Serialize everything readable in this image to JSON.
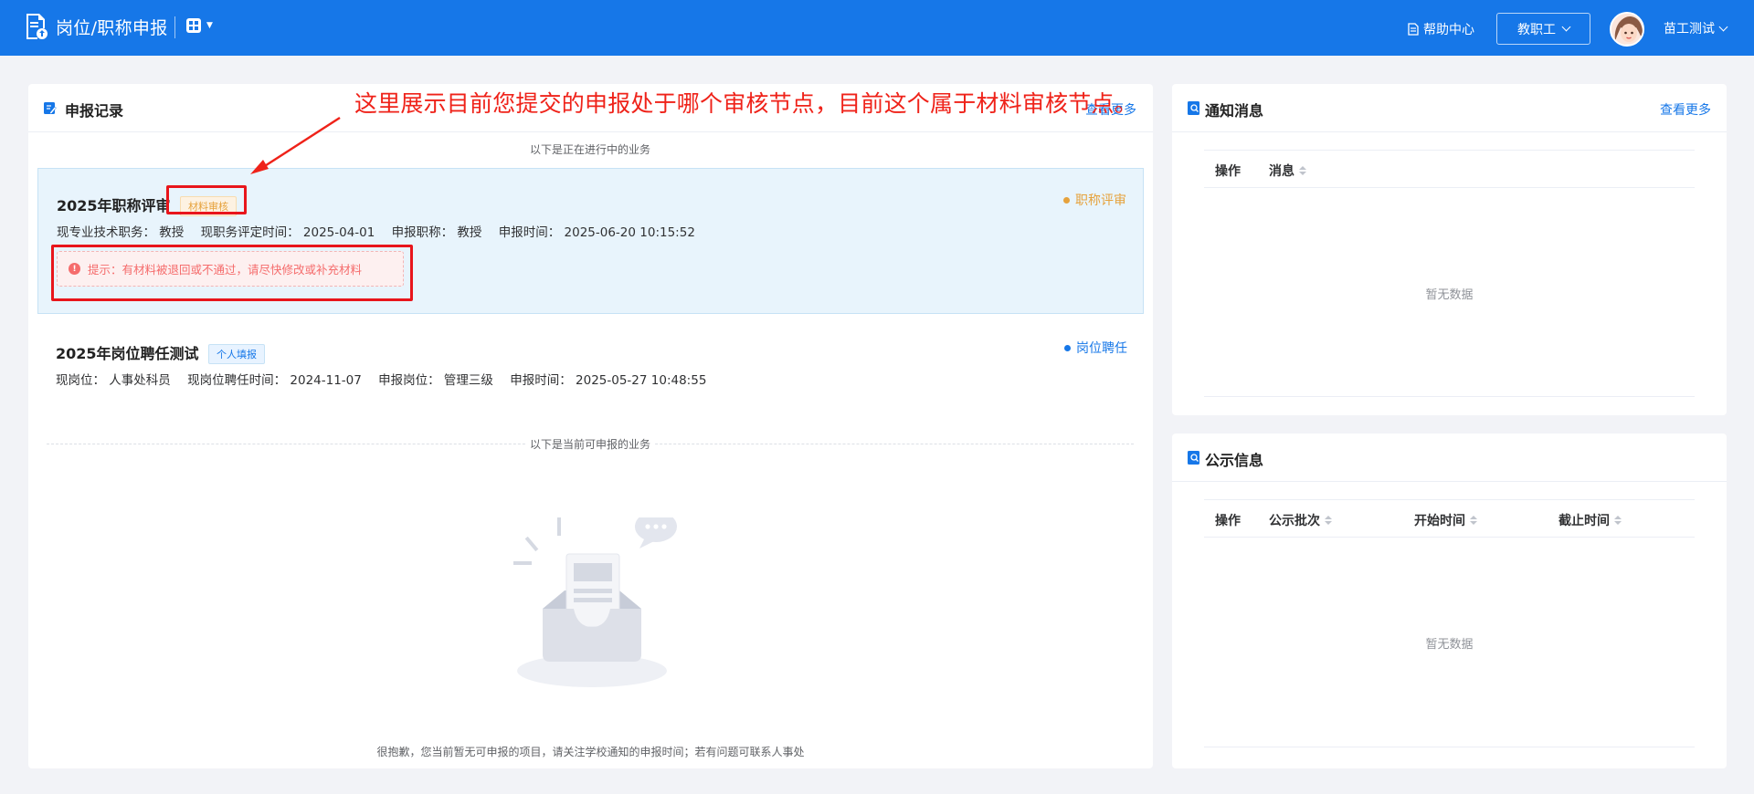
{
  "header": {
    "title": "岗位/职称申报",
    "help_label": "帮助中心",
    "role_label": "教职工",
    "user_name": "苗工测试"
  },
  "records_panel": {
    "title": "申报记录",
    "view_more": "查看更多",
    "in_progress_divider": "以下是正在进行中的业务",
    "available_divider": "以下是当前可申报的业务",
    "empty_note": "很抱歉，您当前暂无可申报的项目，请关注学校通知的申报时间；若有问题可联系人事处",
    "records": [
      {
        "title": "2025年职称评审",
        "tag": "材料审核",
        "type": "职称评审",
        "meta": [
          "现专业技术职务：  教授",
          "现职务评定时间：  2025-04-01",
          "申报职称：  教授",
          "申报时间：  2025-06-20 10:15:52"
        ],
        "warning": "提示：有材料被退回或不通过，请尽快修改或补充材料"
      },
      {
        "title": "2025年岗位聘任测试",
        "tag": "个人填报",
        "type": "岗位聘任",
        "meta": [
          "现岗位：  人事处科员",
          "现岗位聘任时间：  2024-11-07",
          "申报岗位：  管理三级",
          "申报时间：  2025-05-27 10:48:55"
        ]
      }
    ]
  },
  "annotation": "这里展示目前您提交的申报处于哪个审核节点，目前这个属于材料审核节点。",
  "notice_panel": {
    "title": "通知消息",
    "view_more": "查看更多",
    "columns": [
      "操作",
      "消息"
    ],
    "empty": "暂无数据"
  },
  "public_panel": {
    "title": "公示信息",
    "columns": [
      "操作",
      "公示批次",
      "开始时间",
      "截止时间"
    ],
    "empty": "暂无数据"
  },
  "colors": {
    "primary": "#1677e8",
    "warning_orange": "#e6a23c",
    "danger_red": "#f56c6c",
    "annotation_red": "#ef2219"
  }
}
